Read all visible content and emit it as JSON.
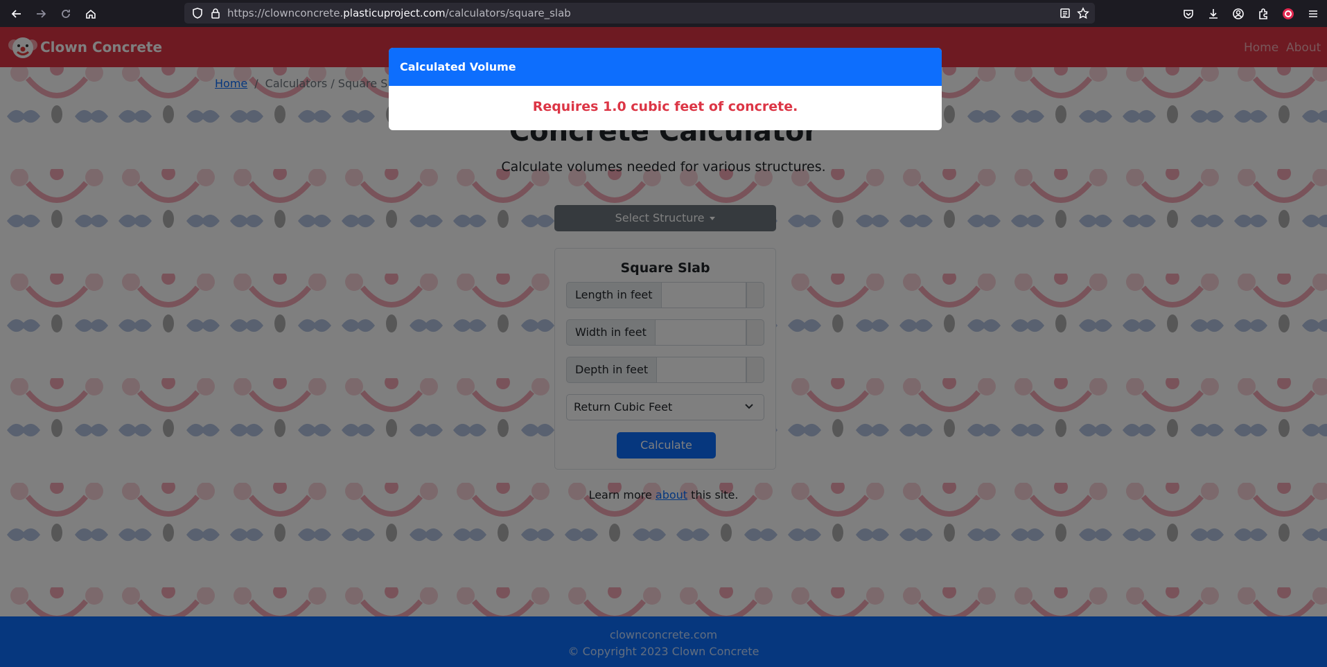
{
  "browser": {
    "url_prefix": "https://clownconcrete.",
    "url_host": "plasticuproject.com",
    "url_path": "/calculators/square_slab",
    "icons": [
      "back-icon",
      "forward-icon",
      "reload-icon",
      "home-icon",
      "shield-icon",
      "lock-icon",
      "reader-icon",
      "star-icon",
      "pocket-icon",
      "download-icon",
      "account-icon",
      "extensions-icon",
      "profile-icon",
      "menu-icon"
    ]
  },
  "navbar": {
    "brand": "Clown Concrete",
    "links": [
      "Home",
      "About"
    ]
  },
  "breadcrumb": {
    "home": "Home",
    "separator": "/",
    "current": "Calculators / Square Slab"
  },
  "hero": {
    "title": "Concrete Calculator",
    "subtitle": "Calculate volumes needed for various structures."
  },
  "structure_dropdown": "Select Structure",
  "calculator": {
    "title": "Square Slab",
    "fields": [
      {
        "label": "Length in feet",
        "value": ""
      },
      {
        "label": "Width in feet",
        "value": ""
      },
      {
        "label": "Depth in feet",
        "value": ""
      }
    ],
    "unit_select": "Return Cubic Feet",
    "button": "Calculate"
  },
  "learn_more": {
    "prefix": "Learn more",
    "link": "about",
    "suffix": "this site."
  },
  "footer": {
    "site": "clownconcrete.com",
    "copyright": "© Copyright 2023 Clown Concrete"
  },
  "modal": {
    "title": "Calculated Volume",
    "message": "Requires 1.0 cubic feet of concrete."
  },
  "colors": {
    "navbar": "#dc3545",
    "primary": "#0d6efd",
    "secondary": "#6c757d",
    "danger": "#dc3545"
  }
}
